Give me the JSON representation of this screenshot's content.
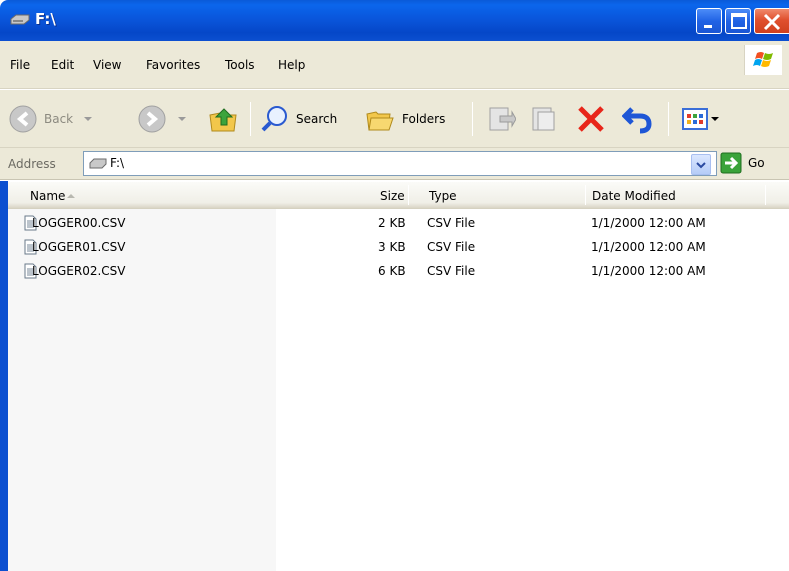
{
  "window": {
    "title": "F:\\"
  },
  "menu": [
    "File",
    "Edit",
    "View",
    "Favorites",
    "Tools",
    "Help"
  ],
  "toolbar": {
    "back_label": "Back",
    "search_label": "Search",
    "folders_label": "Folders"
  },
  "address": {
    "label": "Address",
    "value": "F:\\",
    "go_label": "Go"
  },
  "list": {
    "columns": [
      "Name",
      "Size",
      "Type",
      "Date Modified"
    ],
    "rows": [
      {
        "name": "LOGGER00.CSV",
        "size": "2 KB",
        "type": "CSV File",
        "modified": "1/1/2000 12:00 AM"
      },
      {
        "name": "LOGGER01.CSV",
        "size": "3 KB",
        "type": "CSV File",
        "modified": "1/1/2000 12:00 AM"
      },
      {
        "name": "LOGGER02.CSV",
        "size": "6 KB",
        "type": "CSV File",
        "modified": "1/1/2000 12:00 AM"
      }
    ]
  },
  "colors": {
    "titlebar": "#0a56dc",
    "chrome": "#ece9d8",
    "close_red": "#e0502e"
  }
}
